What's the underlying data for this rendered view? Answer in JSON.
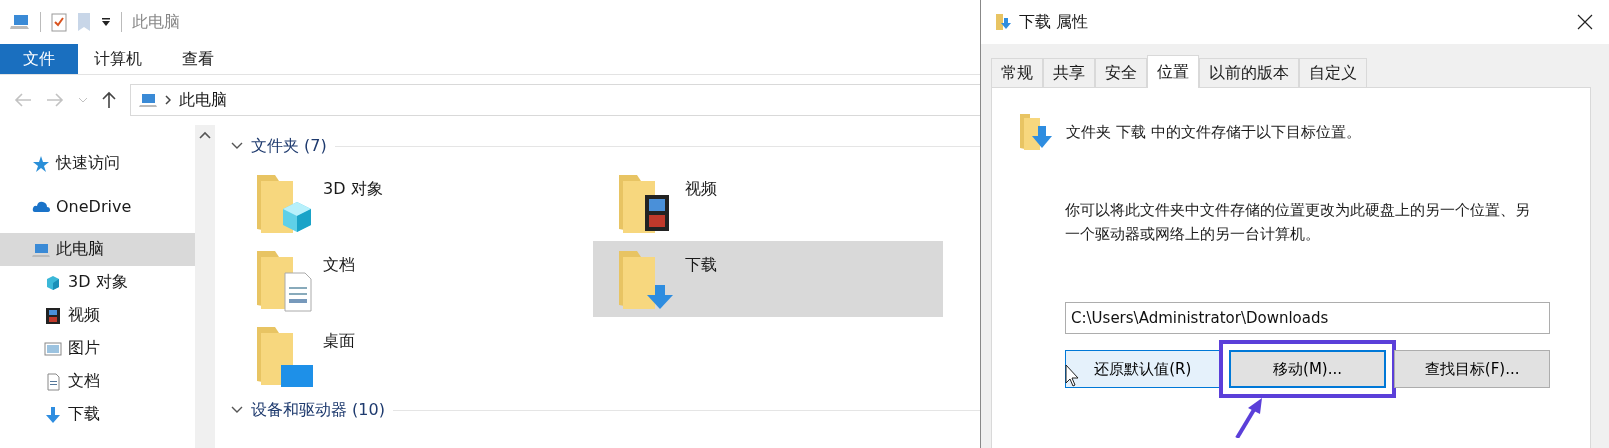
{
  "explorer": {
    "title": "此电脑",
    "ribbon_tabs": [
      {
        "label": "文件",
        "selected": true
      },
      {
        "label": "计算机",
        "selected": false
      },
      {
        "label": "查看",
        "selected": false
      }
    ],
    "address": {
      "path": "此电脑"
    },
    "sidebar": {
      "items": [
        {
          "label": "快速访问",
          "kind": "star",
          "selected": false
        },
        {
          "label": "OneDrive",
          "kind": "cloud",
          "selected": false
        },
        {
          "label": "此电脑",
          "kind": "pc",
          "selected": true,
          "children": [
            {
              "label": "3D 对象",
              "kind": "cube",
              "selected": false
            },
            {
              "label": "视频",
              "kind": "film",
              "selected": false
            },
            {
              "label": "图片",
              "kind": "image",
              "selected": false
            },
            {
              "label": "文档",
              "kind": "doc",
              "selected": false
            },
            {
              "label": "下载",
              "kind": "down",
              "selected": false
            }
          ]
        }
      ]
    },
    "groups": [
      {
        "title": "文件夹 (7)",
        "items": [
          {
            "label": "3D 对象",
            "kind": "cube",
            "selected": false
          },
          {
            "label": "视频",
            "kind": "film",
            "selected": false
          },
          {
            "label": "文档",
            "kind": "doc",
            "selected": false
          },
          {
            "label": "下载",
            "kind": "down",
            "selected": true
          },
          {
            "label": "桌面",
            "kind": "desktop",
            "selected": false
          }
        ]
      },
      {
        "title": "设备和驱动器 (10)"
      }
    ]
  },
  "dialog": {
    "title": "下载 属性",
    "tabs": [
      {
        "label": "常规",
        "selected": false
      },
      {
        "label": "共享",
        "selected": false
      },
      {
        "label": "安全",
        "selected": false
      },
      {
        "label": "位置",
        "selected": true
      },
      {
        "label": "以前的版本",
        "selected": false
      },
      {
        "label": "自定义",
        "selected": false
      }
    ],
    "heading": "文件夹 下载 中的文件存储于以下目标位置。",
    "description": "你可以将此文件夹中文件存储的位置更改为此硬盘上的另一个位置、另一个驱动器或网络上的另一台计算机。",
    "path": "C:\\Users\\Administrator\\Downloads",
    "buttons": [
      {
        "label": "还原默认值(R)",
        "hovered": true,
        "highlighted": false
      },
      {
        "label": "移动(M)...",
        "hovered": false,
        "highlighted": true
      },
      {
        "label": "查找目标(F)...",
        "hovered": false,
        "highlighted": false
      }
    ]
  }
}
